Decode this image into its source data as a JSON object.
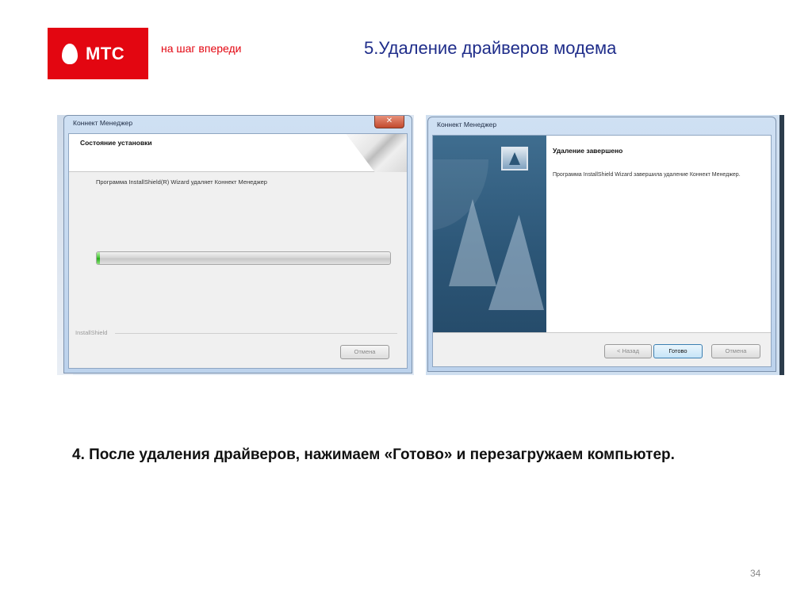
{
  "header": {
    "logo_text": "МТС",
    "slogan": "на шаг впереди",
    "title": "5.Удаление драйверов модема"
  },
  "screenshot_uninstalling": {
    "window_title": "Коннект Менеджер",
    "close_label": "✕",
    "section_title": "Состояние установки",
    "status_text": "Программа InstallShield(R) Wizard удаляет Коннект Менеджер",
    "progress": 0.01,
    "footer_label": "InstallShield",
    "cancel_label": "Отмена"
  },
  "screenshot_complete": {
    "window_title": "Коннект Менеджер",
    "section_title": "Удаление завершено",
    "message": "Программа InstallShield Wizard завершила удаление Коннект Менеджер.",
    "back_label": "< Назад",
    "finish_label": "Готово",
    "cancel_label": "Отмена"
  },
  "caption": "4. После удаления драйверов, нажимаем «Готово» и перезагружаем компьютер.",
  "page_number": "34",
  "colors": {
    "brand_red": "#e30611",
    "title_blue": "#1f2d8a",
    "progress_green": "#23a717"
  }
}
